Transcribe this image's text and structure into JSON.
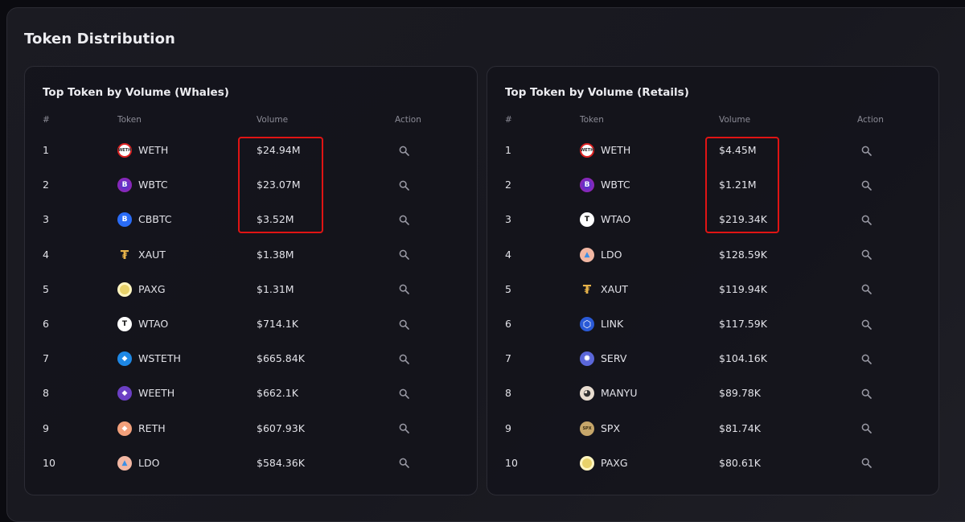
{
  "page_title": "Token Distribution",
  "columns": {
    "num": "#",
    "token": "Token",
    "volume": "Volume",
    "action": "Action"
  },
  "colors": {
    "highlight": "#e01414",
    "background": "#0b0b10",
    "panel": "#16161d"
  },
  "whales": {
    "title": "Top Token by Volume (Whales)",
    "rows": [
      {
        "num": "1",
        "token": "WETH",
        "volume": "$24.94M",
        "icon": "weth-icon"
      },
      {
        "num": "2",
        "token": "WBTC",
        "volume": "$23.07M",
        "icon": "wbtc-icon"
      },
      {
        "num": "3",
        "token": "CBBTC",
        "volume": "$3.52M",
        "icon": "cbbtc-icon"
      },
      {
        "num": "4",
        "token": "XAUT",
        "volume": "$1.38M",
        "icon": "xaut-icon"
      },
      {
        "num": "5",
        "token": "PAXG",
        "volume": "$1.31M",
        "icon": "paxg-icon"
      },
      {
        "num": "6",
        "token": "WTAO",
        "volume": "$714.1K",
        "icon": "wtao-icon"
      },
      {
        "num": "7",
        "token": "WSTETH",
        "volume": "$665.84K",
        "icon": "wsteth-icon"
      },
      {
        "num": "8",
        "token": "WEETH",
        "volume": "$662.1K",
        "icon": "weeth-icon"
      },
      {
        "num": "9",
        "token": "RETH",
        "volume": "$607.93K",
        "icon": "reth-icon"
      },
      {
        "num": "10",
        "token": "LDO",
        "volume": "$584.36K",
        "icon": "ldo-icon"
      }
    ]
  },
  "retails": {
    "title": "Top Token by Volume (Retails)",
    "rows": [
      {
        "num": "1",
        "token": "WETH",
        "volume": "$4.45M",
        "icon": "weth-icon"
      },
      {
        "num": "2",
        "token": "WBTC",
        "volume": "$1.21M",
        "icon": "wbtc-icon"
      },
      {
        "num": "3",
        "token": "WTAO",
        "volume": "$219.34K",
        "icon": "wtao-icon"
      },
      {
        "num": "4",
        "token": "LDO",
        "volume": "$128.59K",
        "icon": "ldo-icon"
      },
      {
        "num": "5",
        "token": "XAUT",
        "volume": "$119.94K",
        "icon": "xaut-icon"
      },
      {
        "num": "6",
        "token": "LINK",
        "volume": "$117.59K",
        "icon": "link-icon"
      },
      {
        "num": "7",
        "token": "SERV",
        "volume": "$104.16K",
        "icon": "serv-icon"
      },
      {
        "num": "8",
        "token": "MANYU",
        "volume": "$89.78K",
        "icon": "manyu-icon"
      },
      {
        "num": "9",
        "token": "SPX",
        "volume": "$81.74K",
        "icon": "spx-icon"
      },
      {
        "num": "10",
        "token": "PAXG",
        "volume": "$80.61K",
        "icon": "paxg-icon"
      }
    ]
  }
}
